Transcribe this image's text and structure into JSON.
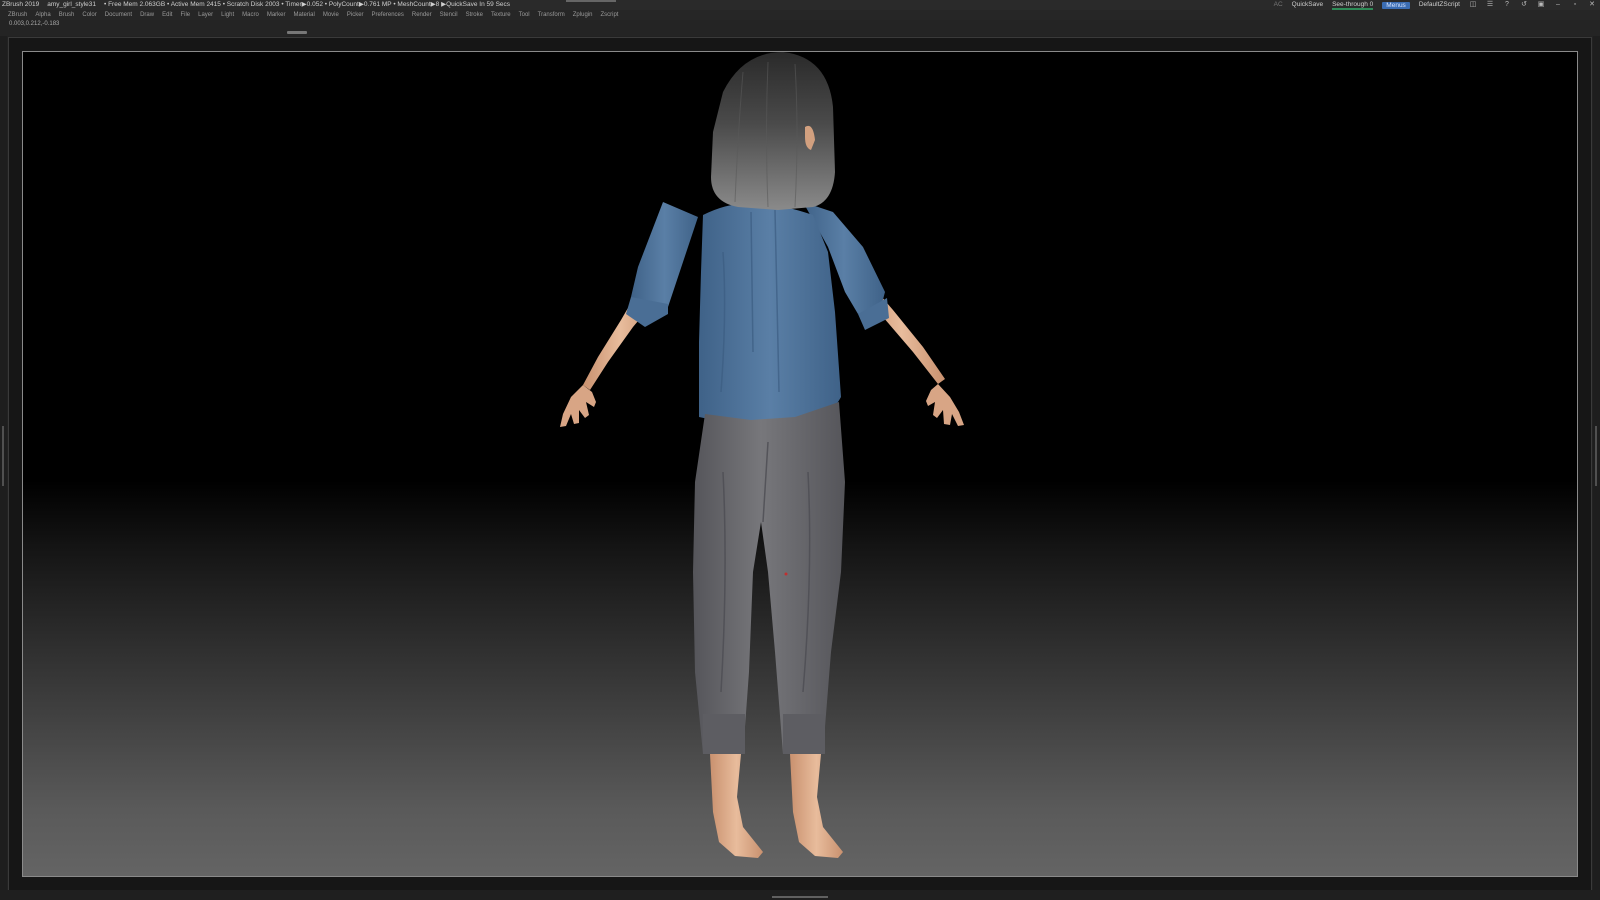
{
  "titlebar": {
    "app_name": "ZBrush 2019",
    "file_name": "amy_girl_style31",
    "stats": "• Free Mem 2.063GB • Active Mem 2415 • Scratch Disk 2003 • Timer▶0.052 • PolyCount▶0.761 MP • MeshCount▶8 ▶QuickSave In 59 Secs",
    "ac_label": "AC",
    "quicksave_label": "QuickSave",
    "see_through_label": "See-through  0",
    "menus_label": "Menus",
    "script_label": "DefaultZScript"
  },
  "menubar": {
    "items": [
      "ZBrush",
      "Alpha",
      "Brush",
      "Color",
      "Document",
      "Draw",
      "Edit",
      "File",
      "Layer",
      "Light",
      "Macro",
      "Marker",
      "Material",
      "Movie",
      "Picker",
      "Preferences",
      "Render",
      "Stencil",
      "Stroke",
      "Texture",
      "Tool",
      "Transform",
      "Zplugin",
      "Zscript"
    ]
  },
  "infobar": {
    "coords": "0.003,0.212,-0.183"
  },
  "viewport": {
    "background_top": "#000000",
    "background_bottom": "#646464",
    "shirt_color": "#4f7398",
    "pants_color": "#6b6b6e",
    "skin_color": "#e2b393",
    "hair_color": "#6e6e6e"
  }
}
